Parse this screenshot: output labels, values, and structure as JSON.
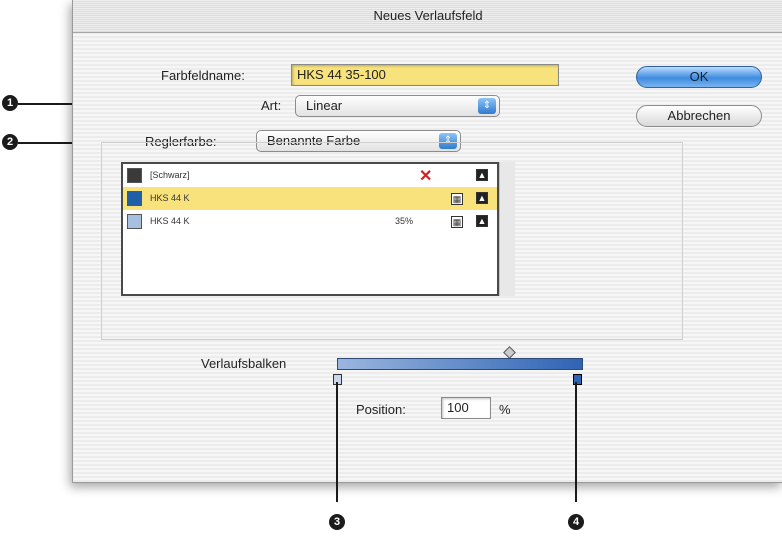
{
  "dialog": {
    "title": "Neues Verlaufsfeld",
    "swatch_name_label": "Farbfeldname:",
    "swatch_name_value": "HKS 44 35-100",
    "type_label": "Art:",
    "type_value": "Linear",
    "stop_color_label": "Reglerfarbe:",
    "stop_color_value": "Benannte Farbe",
    "ok_label": "OK",
    "cancel_label": "Abbrechen",
    "gradient_ramp_label": "Verlaufsbalken",
    "position_label": "Position:",
    "position_value": "100",
    "position_unit": "%"
  },
  "swatch_list": [
    {
      "name": "[Schwarz]",
      "tint": "",
      "color": "#3a3a3a",
      "selected": false,
      "icons": [
        "no-edit-icon",
        "process-color-icon"
      ]
    },
    {
      "name": "HKS 44 K",
      "tint": "",
      "color": "#1f5fa8",
      "selected": true,
      "icons": [
        "spot-color-icon",
        "process-color-icon"
      ]
    },
    {
      "name": "HKS 44 K",
      "tint": "35%",
      "color": "#a7c0e2",
      "selected": false,
      "icons": [
        "spot-color-icon",
        "process-color-icon"
      ]
    }
  ],
  "gradient": {
    "start_color": "#9ab6de",
    "end_color": "#2f64b4",
    "selected_stop": "end"
  },
  "callouts": [
    "1",
    "2",
    "3",
    "4"
  ],
  "colors": {
    "highlight": "#f8e27c",
    "accent": "#3f8be0"
  }
}
